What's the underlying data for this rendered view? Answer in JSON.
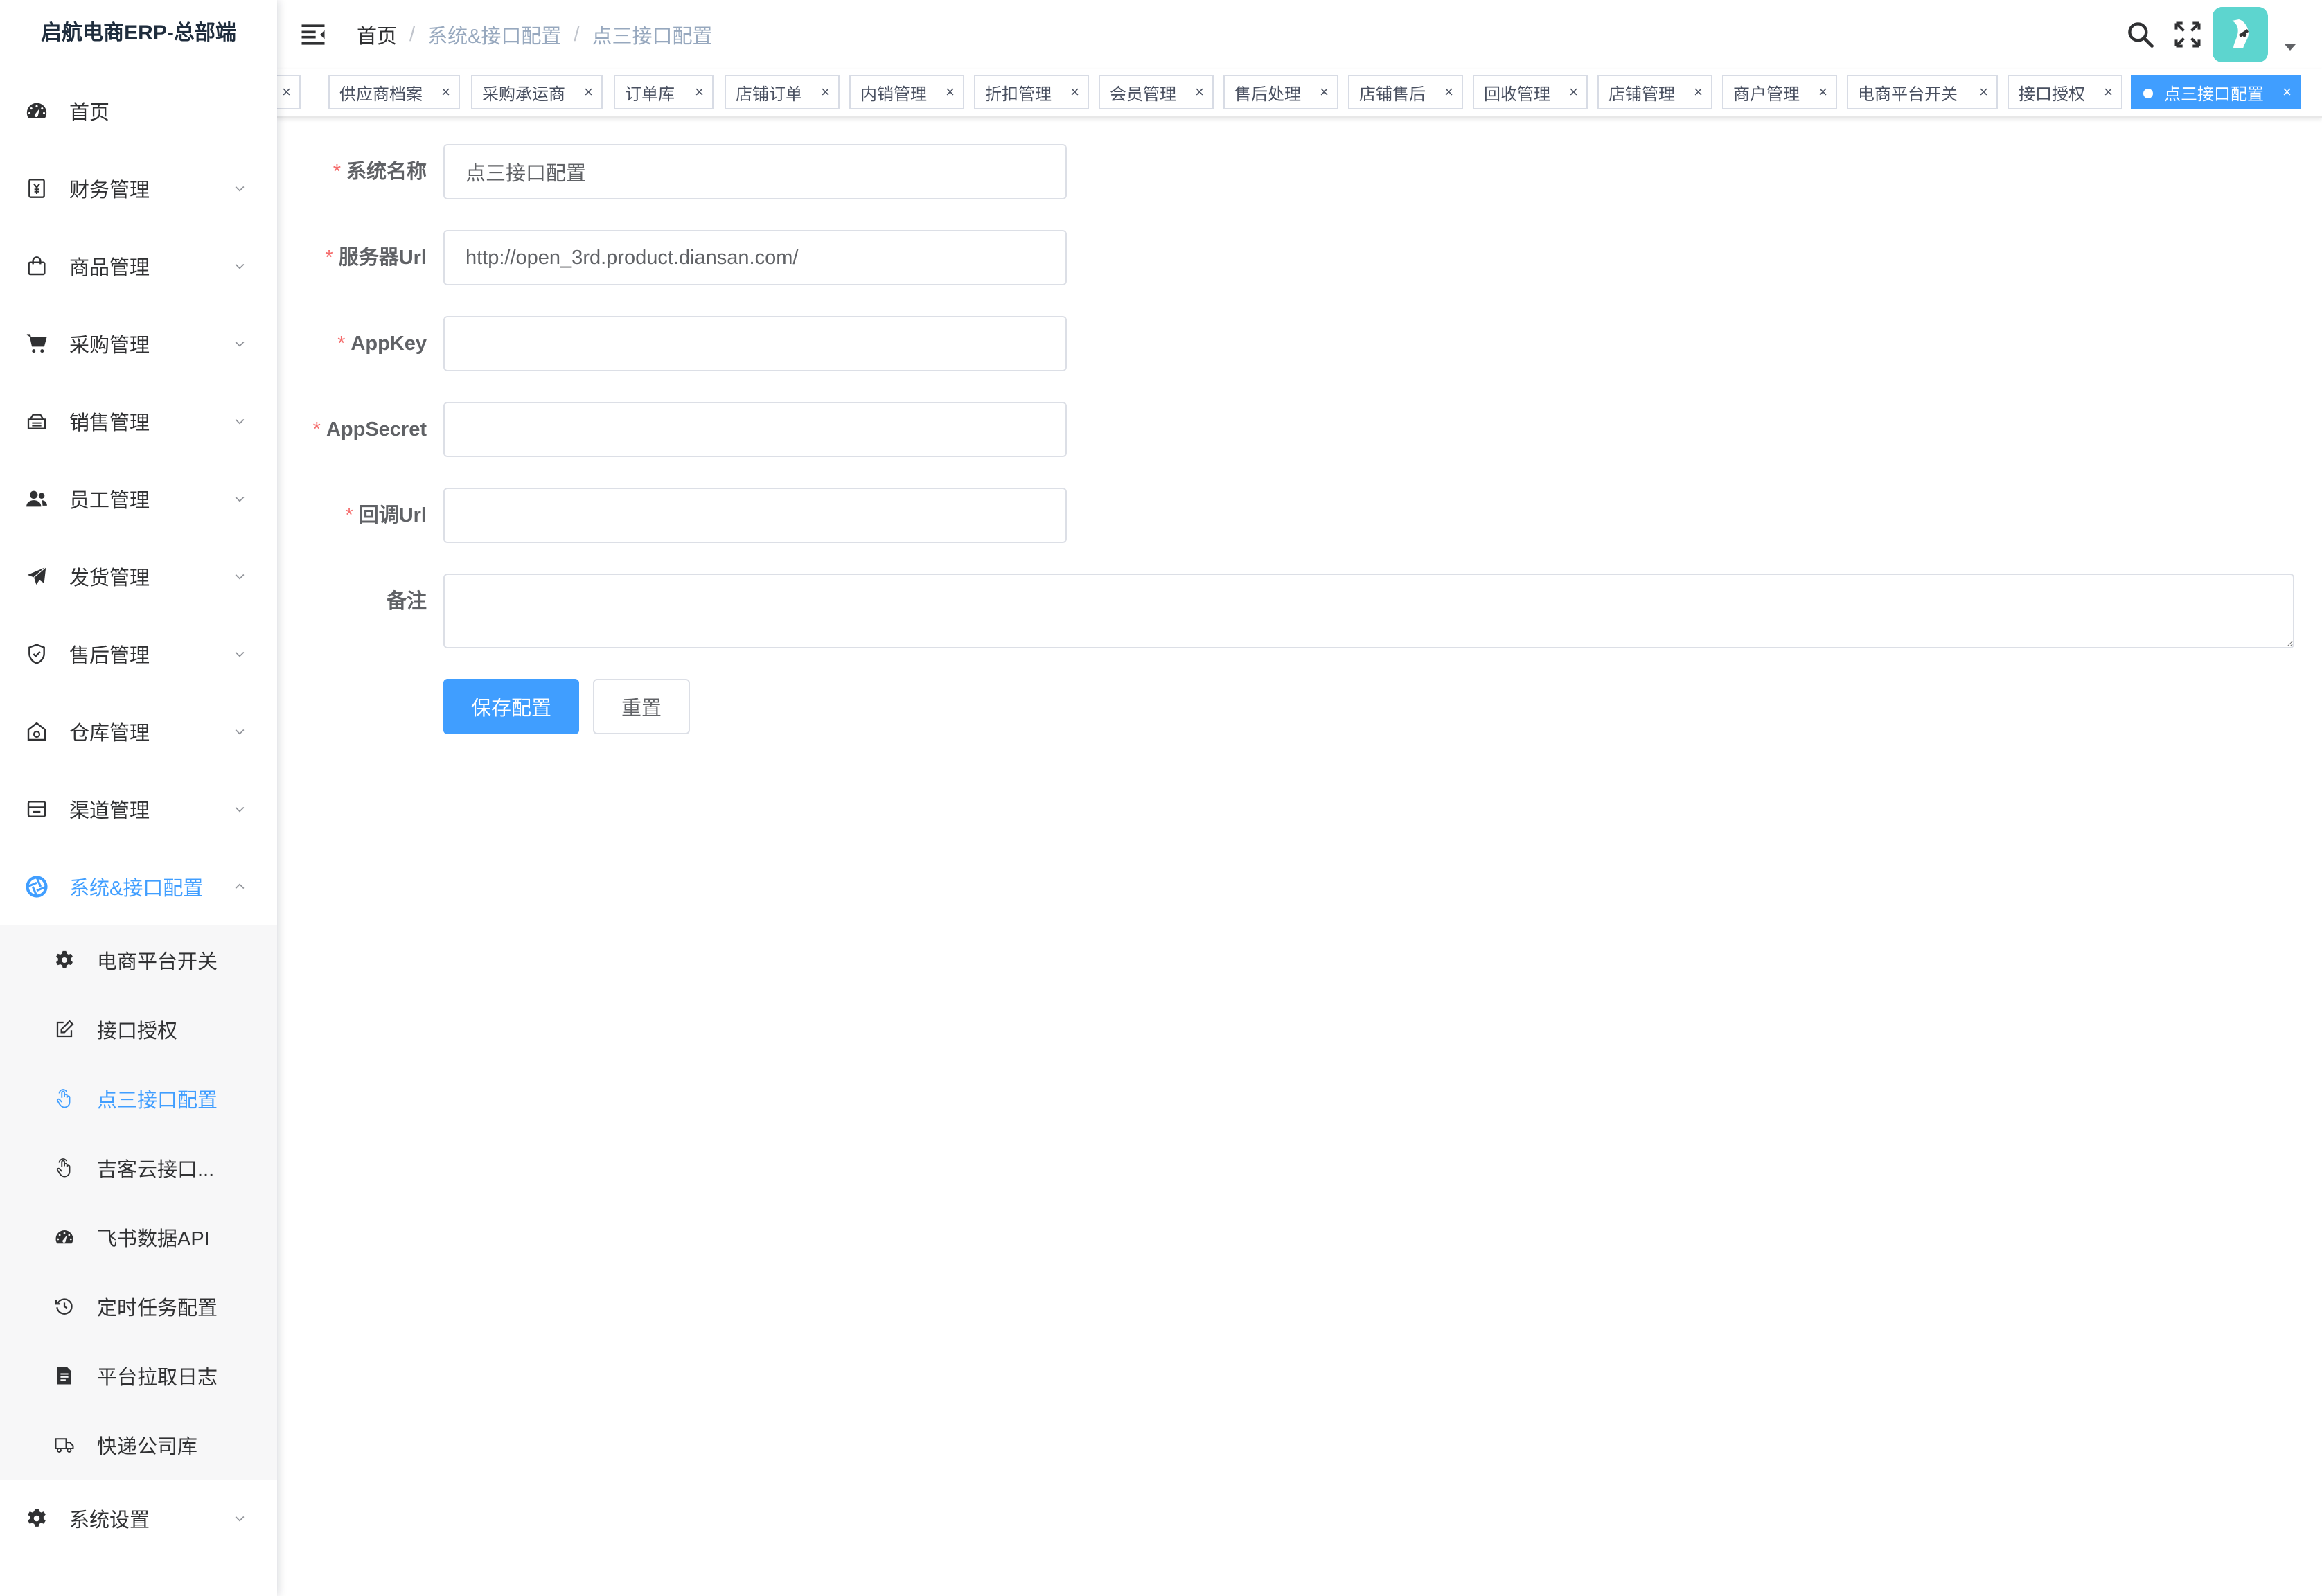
{
  "app": {
    "title": "启航电商ERP-总部端"
  },
  "colors": {
    "accent": "#409EFF",
    "required": "#F56C6C",
    "avatar_bg": "#5dd5cf"
  },
  "sidebar": {
    "items": [
      {
        "label": "首页",
        "icon": "dashboard-icon"
      },
      {
        "label": "财务管理",
        "icon": "finance-icon"
      },
      {
        "label": "商品管理",
        "icon": "shopping-bag-icon"
      },
      {
        "label": "采购管理",
        "icon": "cart-icon"
      },
      {
        "label": "销售管理",
        "icon": "sales-icon"
      },
      {
        "label": "员工管理",
        "icon": "people-icon"
      },
      {
        "label": "发货管理",
        "icon": "paper-plane-icon"
      },
      {
        "label": "售后管理",
        "icon": "shield-icon"
      },
      {
        "label": "仓库管理",
        "icon": "warehouse-icon"
      },
      {
        "label": "渠道管理",
        "icon": "store-icon"
      },
      {
        "label": "系统&接口配置",
        "icon": "aperture-icon"
      },
      {
        "label": "系统设置",
        "icon": "gear-icon"
      }
    ],
    "submenu": [
      {
        "label": "电商平台开关",
        "icon": "gear-icon"
      },
      {
        "label": "接口授权",
        "icon": "edit-icon"
      },
      {
        "label": "点三接口配置",
        "icon": "pointer-icon"
      },
      {
        "label": "吉客云接口...",
        "icon": "pointer-icon"
      },
      {
        "label": "飞书数据API",
        "icon": "dashboard-icon"
      },
      {
        "label": "定时任务配置",
        "icon": "history-icon"
      },
      {
        "label": "平台拉取日志",
        "icon": "document-icon"
      },
      {
        "label": "快递公司库",
        "icon": "truck-icon"
      }
    ]
  },
  "header": {
    "breadcrumb": [
      "首页",
      "系统&接口配置",
      "点三接口配置"
    ],
    "separator": "/",
    "tools": [
      "search-icon",
      "fullscreen-icon",
      "font-size-icon"
    ]
  },
  "tags": [
    {
      "label": "供应商档案"
    },
    {
      "label": "采购承运商"
    },
    {
      "label": "订单库"
    },
    {
      "label": "店铺订单"
    },
    {
      "label": "内销管理"
    },
    {
      "label": "折扣管理"
    },
    {
      "label": "会员管理"
    },
    {
      "label": "售后处理"
    },
    {
      "label": "店铺售后"
    },
    {
      "label": "回收管理"
    },
    {
      "label": "店铺管理"
    },
    {
      "label": "商户管理"
    },
    {
      "label": "电商平台开关"
    },
    {
      "label": "接口授权"
    },
    {
      "label": "点三接口配置",
      "active": true
    }
  ],
  "tag_close": "×",
  "form": {
    "required_mark": "*",
    "system_name": {
      "label": "系统名称",
      "value": "点三接口配置"
    },
    "server_url": {
      "label": "服务器Url",
      "value": "http://open_3rd.product.diansan.com/"
    },
    "app_key": {
      "label": "AppKey",
      "value": ""
    },
    "app_secret": {
      "label": "AppSecret",
      "value": ""
    },
    "callback_url": {
      "label": "回调Url",
      "value": ""
    },
    "remark": {
      "label": "备注",
      "value": ""
    },
    "save_label": "保存配置",
    "reset_label": "重置"
  }
}
